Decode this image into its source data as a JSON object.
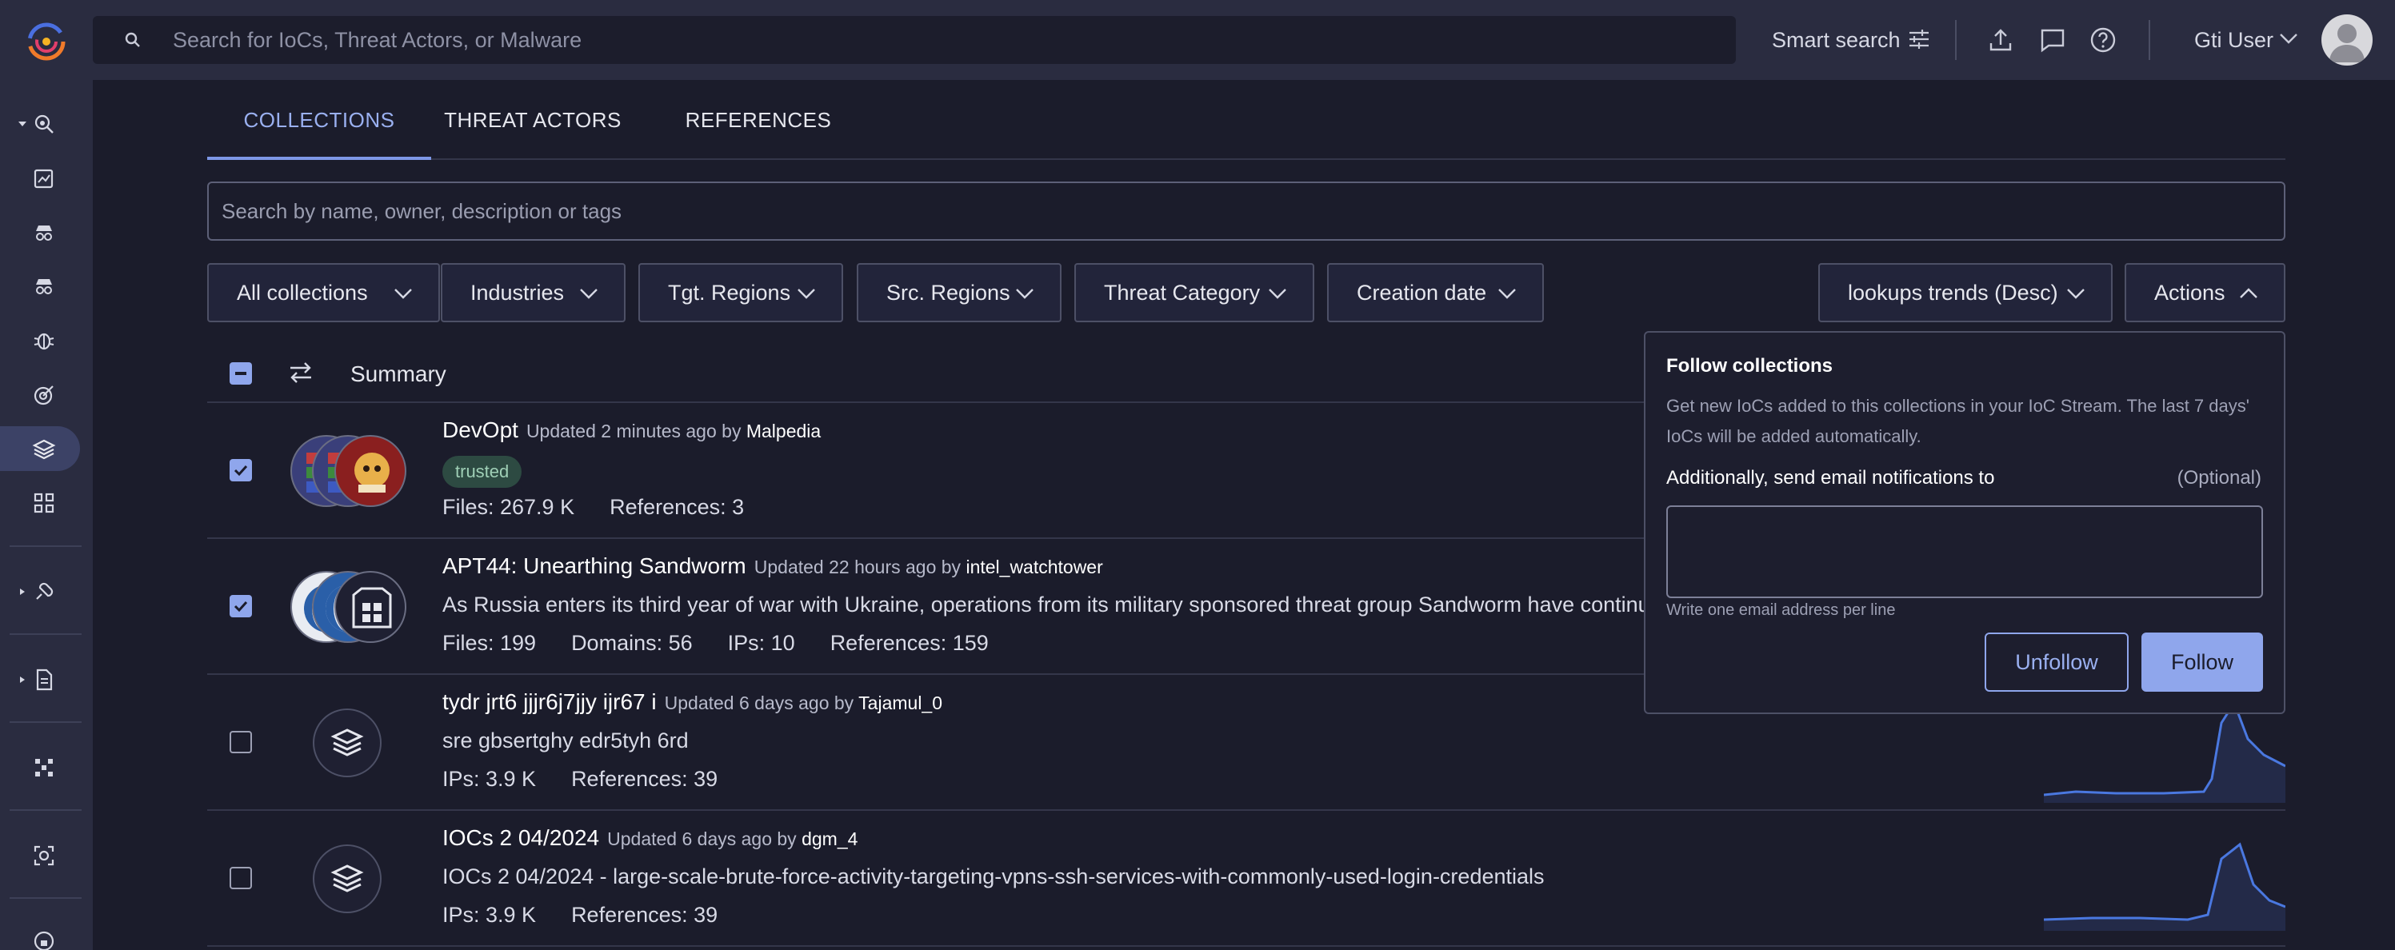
{
  "topbar": {
    "search_placeholder": "Search for IoCs, Threat Actors, or Malware",
    "smart_search_label": "Smart search",
    "user_name": "Gti User"
  },
  "tabs": [
    "COLLECTIONS",
    "THREAT ACTORS",
    "REFERENCES"
  ],
  "collection_search_placeholder": "Search by name, owner, description or tags",
  "filters": {
    "all_collections": "All collections",
    "industries": "Industries",
    "tgt_regions": "Tgt. Regions",
    "src_regions": "Src. Regions",
    "threat_category": "Threat Category",
    "creation_date": "Creation date",
    "sort": "lookups trends (Desc)",
    "actions": "Actions"
  },
  "table": {
    "summary_label": "Summary",
    "rows": [
      {
        "title": "DevOpt",
        "updated": "Updated 2 minutes ago by",
        "owner": "Malpedia",
        "badge": "trusted",
        "stats": [
          "Files: 267.9 K",
          "References: 3"
        ],
        "checked": true
      },
      {
        "title": "APT44: Unearthing Sandworm",
        "updated": "Updated 22 hours ago by",
        "owner": "intel_watchtower",
        "description": "As Russia enters its third year of war with Ukraine, operations from its military sponsored threat group Sandworm have continued",
        "stats": [
          "Files: 199",
          "Domains: 56",
          "IPs: 10",
          "References: 159"
        ],
        "checked": true
      },
      {
        "title": "tydr jrt6 jjjr6j7jjy ijr67 i",
        "updated": "Updated 6 days ago by",
        "owner": "Tajamul_0",
        "description": "sre gbsertghy edr5tyh 6rd",
        "stats": [
          "IPs: 3.9 K",
          "References: 39"
        ],
        "checked": false
      },
      {
        "title": "IOCs 2 04/2024",
        "updated": "Updated 6 days ago by",
        "owner": "dgm_4",
        "description": "IOCs 2 04/2024 - large-scale-brute-force-activity-targeting-vpns-ssh-services-with-commonly-used-login-credentials",
        "stats": [
          "IPs: 3.9 K",
          "References: 39"
        ],
        "checked": false
      }
    ]
  },
  "actions_panel": {
    "title": "Follow collections",
    "description": "Get new IoCs added to this collections in your IoC Stream. The last 7 days' IoCs will be added automatically.",
    "email_label": "Additionally, send email notifications to",
    "optional_label": "(Optional)",
    "email_value": "",
    "hint": "Write one email address per line",
    "unfollow_label": "Unfollow",
    "follow_label": "Follow"
  },
  "colors": {
    "accent": "#8fa6ec",
    "background": "#1b1c2b",
    "chrome": "#2a2c40",
    "badge_bg": "#2d4a42"
  },
  "icons": {
    "sidebar": [
      "search-bug-icon",
      "report-icon",
      "threat-actor-icon",
      "threat-actor-icon",
      "malware-icon",
      "campaign-target-icon",
      "collections-icon",
      "apps-icon",
      "hunting-icon",
      "document-icon",
      "graph-icon",
      "scan-icon",
      "lock-icon"
    ]
  }
}
